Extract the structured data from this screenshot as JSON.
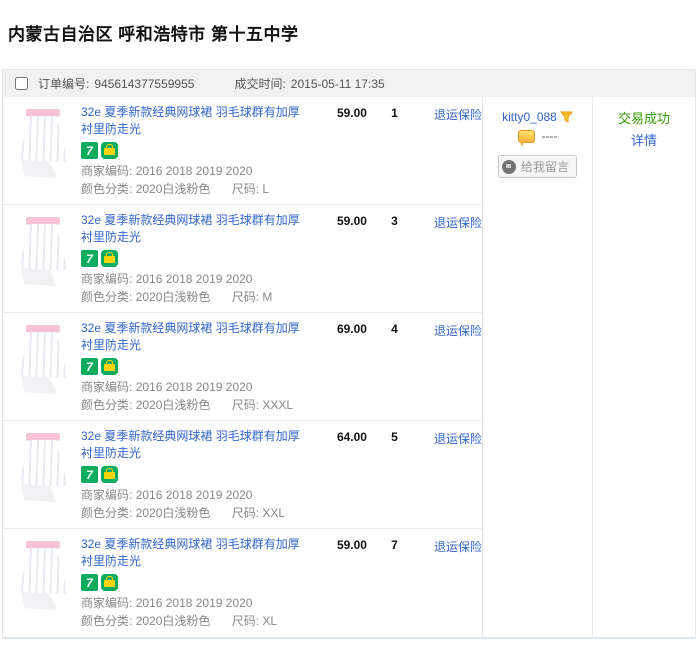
{
  "page_title": "内蒙古自治区 呼和浩特市 第十五中学",
  "order_header": {
    "order_no_label": "订单编号:",
    "order_no": "945614377559955",
    "deal_time_label": "成交时间:",
    "deal_time": "2015-05-11 17:35"
  },
  "badges": {
    "seven_day_return": "7"
  },
  "items": [
    {
      "title": "32e 夏季新款经典网球裙 羽毛球群有加厚衬里防走光",
      "merchant_label": "商家编码:",
      "merchant_code": "2016 2018 2019 2020",
      "color_label": "颜色分类:",
      "color_value": "2020白浅粉色",
      "size_label": "尺码:",
      "size": "L",
      "price": "59.00",
      "qty": "1",
      "insurance_label": "退运保险"
    },
    {
      "title": "32e 夏季新款经典网球裙 羽毛球群有加厚衬里防走光",
      "merchant_label": "商家编码:",
      "merchant_code": "2016 2018 2019 2020",
      "color_label": "颜色分类:",
      "color_value": "2020白浅粉色",
      "size_label": "尺码:",
      "size": "M",
      "price": "59.00",
      "qty": "3",
      "insurance_label": "退运保险"
    },
    {
      "title": "32e 夏季新款经典网球裙 羽毛球群有加厚衬里防走光",
      "merchant_label": "商家编码:",
      "merchant_code": "2016 2018 2019 2020",
      "color_label": "颜色分类:",
      "color_value": "2020白浅粉色",
      "size_label": "尺码:",
      "size": "XXXL",
      "price": "69.00",
      "qty": "4",
      "insurance_label": "退运保险"
    },
    {
      "title": "32e 夏季新款经典网球裙 羽毛球群有加厚衬里防走光",
      "merchant_label": "商家编码:",
      "merchant_code": "2016 2018 2019 2020",
      "color_label": "颜色分类:",
      "color_value": "2020白浅粉色",
      "size_label": "尺码:",
      "size": "XXL",
      "price": "64.00",
      "qty": "5",
      "insurance_label": "退运保险"
    },
    {
      "title": "32e 夏季新款经典网球裙 羽毛球群有加厚衬里防走光",
      "merchant_label": "商家编码:",
      "merchant_code": "2016 2018 2019 2020",
      "color_label": "颜色分类:",
      "color_value": "2020白浅粉色",
      "size_label": "尺码:",
      "size": "XL",
      "price": "59.00",
      "qty": "7",
      "insurance_label": "退运保险"
    }
  ],
  "buyer": {
    "username": "kitty0_088",
    "memo": "----",
    "leave_message_label": "给我留言"
  },
  "status": {
    "state_label": "交易成功",
    "detail_label": "详情"
  },
  "colors": {
    "link_blue": "#3366cc",
    "success_green": "#339900",
    "badge_green": "#0cab60",
    "accent_orange": "#fcaf3e",
    "header_bar_bg": "#f1f1f1"
  }
}
